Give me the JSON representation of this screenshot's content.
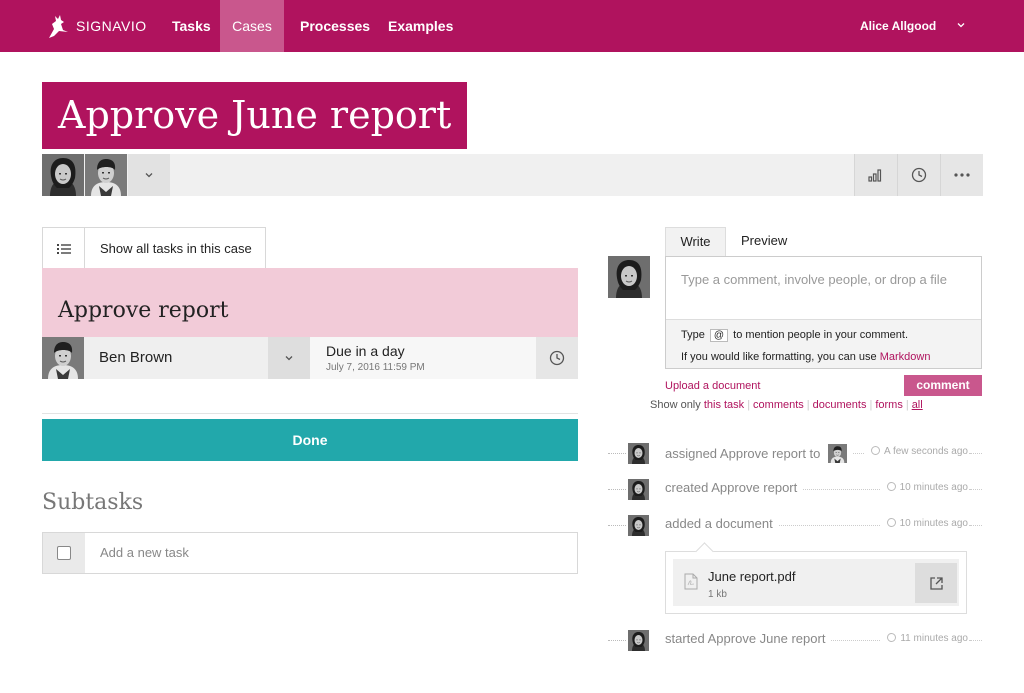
{
  "nav": {
    "logo": "SIGNAVIO",
    "items": [
      {
        "label": "Tasks",
        "active": false
      },
      {
        "label": "Cases",
        "active": true
      },
      {
        "label": "Processes",
        "active": false
      },
      {
        "label": "Examples",
        "active": false
      }
    ],
    "user": "Alice Allgood",
    "accent_color": "#b0135e"
  },
  "case": {
    "title": "Approve June report",
    "participants": [
      "female-avatar",
      "male-avatar"
    ],
    "toolbar_icons": [
      "stats-icon",
      "history-icon",
      "more-icon"
    ]
  },
  "task": {
    "show_all_label": "Show all tasks in this case",
    "name": "Approve report",
    "assignee": "Ben Brown",
    "due_title": "Due in a day",
    "due_date": "July 7, 2016 11:59 PM",
    "done_label": "Done",
    "subtasks_heading": "Subtasks",
    "new_task_placeholder": "Add a new task",
    "done_color": "#22a8ab"
  },
  "comment": {
    "tabs": [
      "Write",
      "Preview"
    ],
    "placeholder": "Type a comment, involve people, or drop a file",
    "help_type": "Type",
    "help_key": "@",
    "help_mention": "to mention people in your comment.",
    "help_formatting": "If you would like formatting, you can use",
    "help_markdown": "Markdown",
    "upload_label": "Upload a document",
    "submit_label": "comment"
  },
  "filters": {
    "prefix": "Show only",
    "options": [
      "this task",
      "comments",
      "documents",
      "forms",
      "all"
    ]
  },
  "activity": [
    {
      "text": "assigned Approve report to",
      "time": "A few seconds ago"
    },
    {
      "text": "created Approve report",
      "time": "10 minutes ago"
    },
    {
      "text": "added a document",
      "time": "10 minutes ago"
    },
    {
      "text": "started Approve June report",
      "time": "11 minutes ago"
    }
  ],
  "document": {
    "name": "June report.pdf",
    "size": "1 kb"
  }
}
